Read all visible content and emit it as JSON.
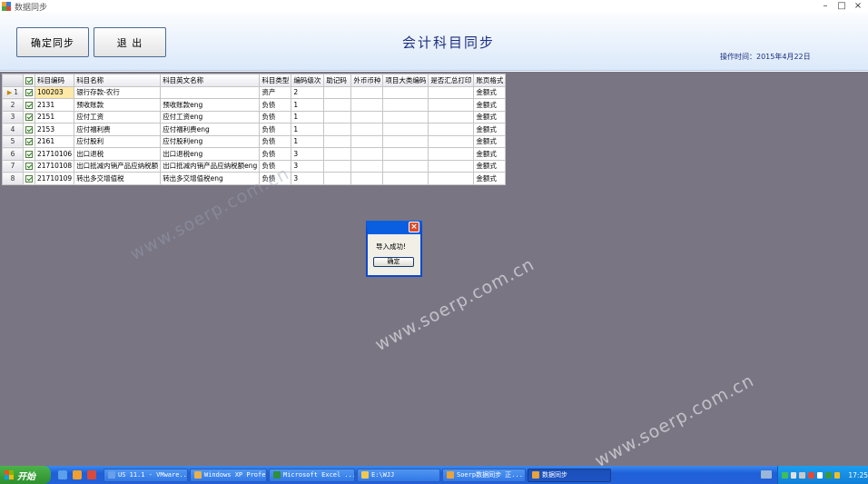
{
  "window": {
    "title": "数据同步"
  },
  "header": {
    "sync_label": "确定同步",
    "exit_label": "退  出",
    "title": "会计科目同步",
    "op_time_label": "操作时间：",
    "op_time": "2015年4月22日"
  },
  "grid": {
    "columns": [
      "科目编码",
      "科目名称",
      "科目英文名称",
      "科目类型",
      "编码级次",
      "助记码",
      "外币币种",
      "项目大类编码",
      "是否汇总打印",
      "账页格式"
    ],
    "rows": [
      {
        "no": "1",
        "code": "100203",
        "name": "银行存款-农行",
        "en": "",
        "type": "资产",
        "level": "2",
        "mnemonic": "",
        "currency": "",
        "project": "",
        "summary": "",
        "format": "金额式"
      },
      {
        "no": "2",
        "code": "2131",
        "name": "预收账款",
        "en": "预收账款eng",
        "type": "负债",
        "level": "1",
        "mnemonic": "",
        "currency": "",
        "project": "",
        "summary": "",
        "format": "金额式"
      },
      {
        "no": "3",
        "code": "2151",
        "name": "应付工资",
        "en": "应付工资eng",
        "type": "负债",
        "level": "1",
        "mnemonic": "",
        "currency": "",
        "project": "",
        "summary": "",
        "format": "金额式"
      },
      {
        "no": "4",
        "code": "2153",
        "name": "应付福利费",
        "en": "应付福利费eng",
        "type": "负债",
        "level": "1",
        "mnemonic": "",
        "currency": "",
        "project": "",
        "summary": "",
        "format": "金额式"
      },
      {
        "no": "5",
        "code": "2161",
        "name": "应付股利",
        "en": "应付股利eng",
        "type": "负债",
        "level": "1",
        "mnemonic": "",
        "currency": "",
        "project": "",
        "summary": "",
        "format": "金额式"
      },
      {
        "no": "6",
        "code": "21710106",
        "name": "出口退税",
        "en": "出口退税eng",
        "type": "负债",
        "level": "3",
        "mnemonic": "",
        "currency": "",
        "project": "",
        "summary": "",
        "format": "金额式"
      },
      {
        "no": "7",
        "code": "21710108",
        "name": "出口抵减内销产品应纳税额",
        "en": "出口抵减内销产品应纳税额eng",
        "type": "负债",
        "level": "3",
        "mnemonic": "",
        "currency": "",
        "project": "",
        "summary": "",
        "format": "金额式"
      },
      {
        "no": "8",
        "code": "21710109",
        "name": "转出多交增值税",
        "en": "转出多交增值税eng",
        "type": "负债",
        "level": "3",
        "mnemonic": "",
        "currency": "",
        "project": "",
        "summary": "",
        "format": "金额式"
      }
    ]
  },
  "watermark": {
    "text": "www.soerp.com.cn"
  },
  "dialog": {
    "message": "导入成功!",
    "ok_label": "确定"
  },
  "taskbar": {
    "start_label": "开始",
    "tasks": [
      {
        "label": "US 11.1 - VMware...",
        "icon_color": "#6aa0e8"
      },
      {
        "label": "Windows XP Profe...",
        "icon_color": "#e8b04a"
      },
      {
        "label": "Microsoft Excel ...",
        "icon_color": "#2f8f3a"
      },
      {
        "label": "E:\\WJJ",
        "icon_color": "#f0c850"
      },
      {
        "label": "Soerp数据同步 正...",
        "icon_color": "#e8a33a"
      },
      {
        "label": "数据同步",
        "icon_color": "#e8a33a"
      }
    ],
    "clock": "17:25"
  },
  "colors": {
    "accent": "#1d2f80",
    "client_bg": "#797583",
    "dialog_border": "#0a49d2",
    "taskbar": "#2361d8"
  }
}
